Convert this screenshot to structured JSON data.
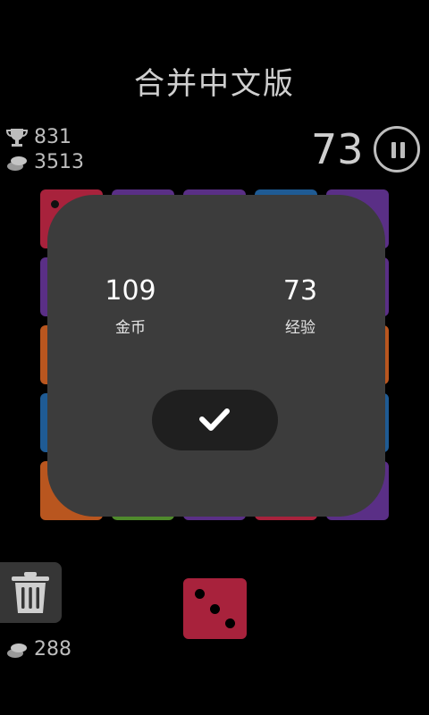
{
  "title": "合并中文版",
  "stats": {
    "trophy": "831",
    "coins": "3513",
    "bottom_coins": "288"
  },
  "score": "73",
  "result": {
    "coins_value": "109",
    "coins_label": "金币",
    "exp_value": "73",
    "exp_label": "经验"
  },
  "colors": {
    "red": "#a8223c",
    "purple": "#5a2f86",
    "orange": "#b9561f",
    "blue": "#1f5b94",
    "green": "#4f8a2c",
    "overlay": "#3c3c3c",
    "button": "#1f1f1f",
    "dice": "#a8223c"
  },
  "icons": [
    "trophy-icon",
    "coin-stack-icon",
    "pause-icon",
    "checkmark-icon",
    "trash-icon",
    "dice-icon"
  ]
}
